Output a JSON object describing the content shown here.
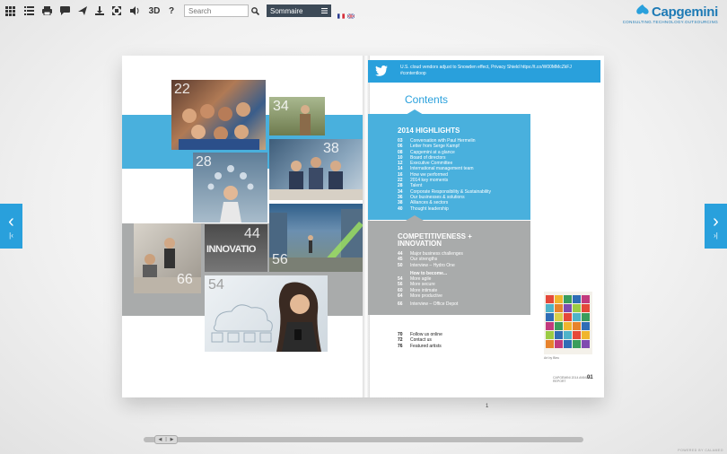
{
  "toolbar": {
    "icons": [
      "grid-icon",
      "list-icon",
      "print-icon",
      "comment-icon",
      "share-icon",
      "download-icon",
      "fullscreen-icon",
      "sound-icon"
    ],
    "view3d_label": "3D",
    "help_label": "?",
    "search_placeholder": "Search",
    "sommaire_label": "Sommaire",
    "sommaire_icon": "menu-icon",
    "flags": [
      {
        "name": "french-flag-icon"
      },
      {
        "name": "uk-flag-icon"
      }
    ]
  },
  "logo": {
    "name": "Capgemini",
    "tagline": "CONSULTING.TECHNOLOGY.OUTSOURCING"
  },
  "nav": {
    "prev_icon": "chevron-left-icon",
    "next_icon": "chevron-right-icon",
    "first_icon": "first-page-icon",
    "last_icon": "last-page-icon"
  },
  "left_page": {
    "photo_numbers": [
      "22",
      "34",
      "28",
      "38",
      "44",
      "56",
      "54",
      "66"
    ],
    "innovation_word": "INNOVATIO"
  },
  "right_page": {
    "tweet_text": "U.S. cloud vendors adjust to Snowden effect, Privacy Shield https://t.co/W00MMcZkFJ #contentloop",
    "title": "Contents",
    "section1_title": "2014 HIGHLIGHTS",
    "section1_items": [
      {
        "n": "03",
        "t": "Conversation with Paul Hermelin"
      },
      {
        "n": "06",
        "t": "Letter from Serge Kampf"
      },
      {
        "n": "08",
        "t": "Capgemini at a glance"
      },
      {
        "n": "10",
        "t": "Board of directors"
      },
      {
        "n": "12",
        "t": "Executive Committee"
      },
      {
        "n": "14",
        "t": "International management team"
      },
      {
        "n": "16",
        "t": "How we performed"
      },
      {
        "n": "22",
        "t": "2014 key moments"
      },
      {
        "n": "28",
        "t": "Talent"
      },
      {
        "n": "34",
        "t": "Corporate Responsibility & Sustainability"
      },
      {
        "n": "36",
        "t": "Our businesses & solutions"
      },
      {
        "n": "38",
        "t": "Alliances & sectors"
      },
      {
        "n": "40",
        "t": "Thought leadership"
      }
    ],
    "section2_title_line1": "COMPETITIVENESS +",
    "section2_title_line2": "INNOVATION",
    "section2_items": [
      {
        "n": "44",
        "t": "Major business challenges"
      },
      {
        "n": "45",
        "t": "Our strengths"
      },
      {
        "n": "50",
        "t": "Interview – Hydro One"
      }
    ],
    "section2_sub": "How to become...",
    "section2_items_b": [
      {
        "n": "54",
        "t": "More agile"
      },
      {
        "n": "56",
        "t": "More secure"
      },
      {
        "n": "60",
        "t": "More intimate"
      },
      {
        "n": "64",
        "t": "More productive"
      },
      {
        "n": "66",
        "t": "Interview – Office Depot"
      }
    ],
    "section3_items": [
      {
        "n": "70",
        "t": "Follow us online"
      },
      {
        "n": "72",
        "t": "Contact us"
      },
      {
        "n": "76",
        "t": "Featured artists"
      }
    ],
    "artwork_caption": "Art by Bleu",
    "footer_text": "CAPGEMINI 2014 ANNUAL REPORT",
    "page_number": "01"
  },
  "page_indicator": "1",
  "scrollbar": {
    "position": 0.02
  },
  "powered_by": "POWERED BY CALAMEO"
}
